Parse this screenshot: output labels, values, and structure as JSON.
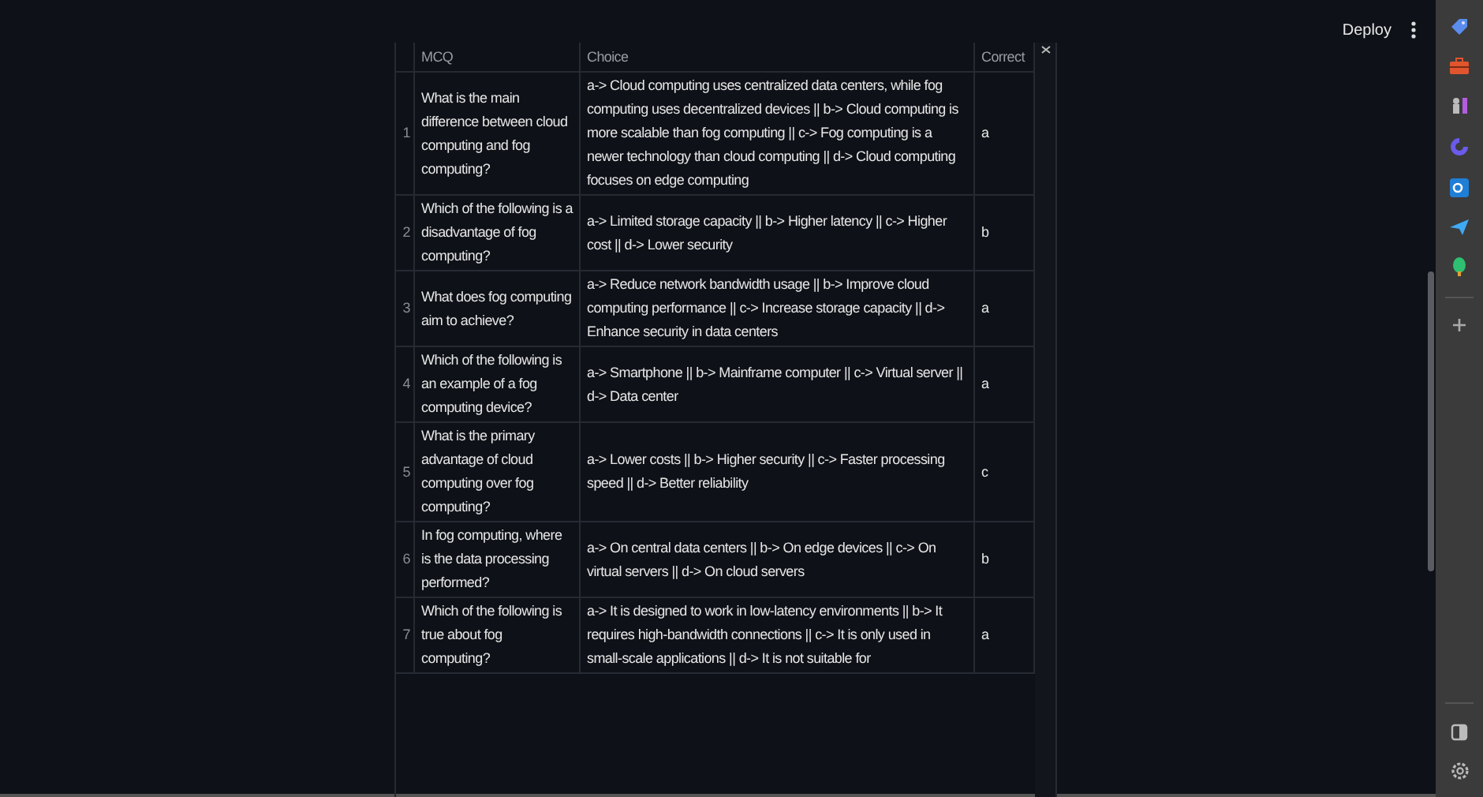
{
  "header": {
    "deploy": "Deploy"
  },
  "table": {
    "columns": [
      "MCQ",
      "Choice",
      "Correct"
    ],
    "rows": [
      {
        "index": "1",
        "mcq": "What is the main difference between cloud computing and fog computing?",
        "choice": "a-> Cloud computing uses centralized data centers, while fog computing uses decentralized devices || b-> Cloud computing is more scalable than fog computing || c-> Fog computing is a newer technology than cloud computing || d-> Cloud computing focuses on edge computing",
        "correct": "a"
      },
      {
        "index": "2",
        "mcq": "Which of the following is a disadvantage of fog computing?",
        "choice": "a-> Limited storage capacity || b-> Higher latency || c-> Higher cost || d-> Lower security",
        "correct": "b"
      },
      {
        "index": "3",
        "mcq": "What does fog computing aim to achieve?",
        "choice": "a-> Reduce network bandwidth usage || b-> Improve cloud computing performance || c-> Increase storage capacity || d-> Enhance security in data centers",
        "correct": "a"
      },
      {
        "index": "4",
        "mcq": "Which of the following is an example of a fog computing device?",
        "choice": "a-> Smartphone || b-> Mainframe computer || c-> Virtual server || d-> Data center",
        "correct": "a"
      },
      {
        "index": "5",
        "mcq": "What is the primary advantage of cloud computing over fog computing?",
        "choice": "a-> Lower costs || b-> Higher security || c-> Faster processing speed || d-> Better reliability",
        "correct": "c"
      },
      {
        "index": "6",
        "mcq": "In fog computing, where is the data processing performed?",
        "choice": "a-> On central data centers || b-> On edge devices || c-> On virtual servers || d-> On cloud servers",
        "correct": "b"
      },
      {
        "index": "7",
        "mcq": "Which of the following is true about fog computing?",
        "choice": "a-> It is designed to work in low-latency environments || b-> It requires high-bandwidth connections || c-> It is only used in small-scale applications || d-> It is not suitable for",
        "correct": "a"
      }
    ]
  }
}
